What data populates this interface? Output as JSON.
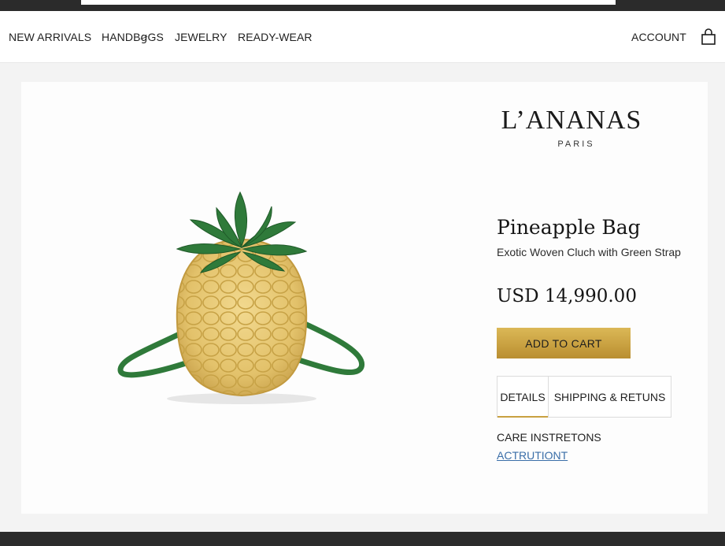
{
  "nav": {
    "items": [
      {
        "label": "NEW ARRIVALS"
      },
      {
        "label": "HANDBꞡGS"
      },
      {
        "label": "JEWELRY"
      },
      {
        "label": "READY-WEAR"
      }
    ],
    "account_label": "ACCOUNT",
    "cart_icon": "shopping-bag-icon"
  },
  "brand": {
    "name": "L’ANANAS",
    "city": "PARIS"
  },
  "product": {
    "title": "Pineapple Bag",
    "subtitle": "Exotic Woven Cluch with Green Strap",
    "price": "USD 14,990.00",
    "image_icon": "pineapple-bag-image"
  },
  "actions": {
    "add_to_cart_label": "ADD TO CART"
  },
  "tabs": [
    {
      "label": "DETAILS",
      "active": true
    },
    {
      "label": "SHIPPING & RETUNS",
      "active": false
    }
  ],
  "care": {
    "title": "CARE INSTRETONS",
    "link": "ACTRUTIONT"
  },
  "colors": {
    "accent_gold": "#c9a141",
    "link_blue": "#3a6ea8",
    "strap_green": "#2f7a3a",
    "chrome_dark": "#2b2b2b"
  }
}
